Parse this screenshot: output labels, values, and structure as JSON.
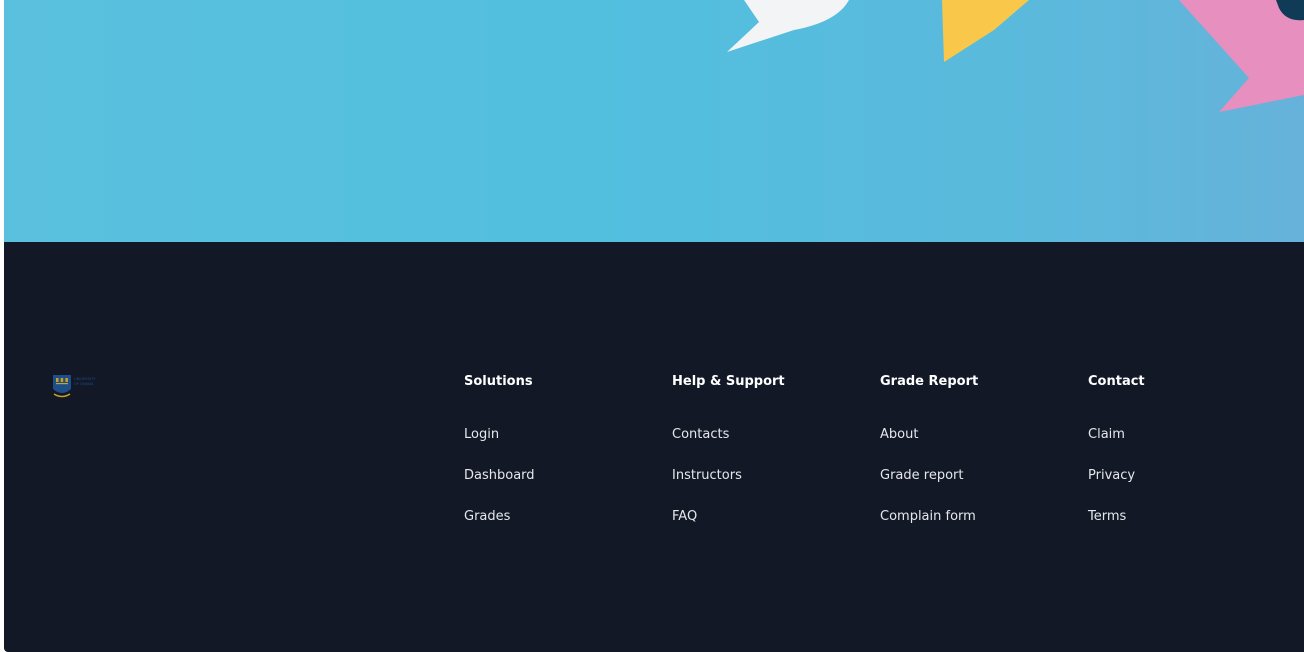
{
  "hero": {
    "background_color": "#55bedf",
    "shape_colors": {
      "white": "#f3f4f5",
      "yellow": "#f9c84a",
      "pink": "#e78fbf",
      "navy": "#0f3b57"
    }
  },
  "footer": {
    "background_color": "#121826",
    "logo": {
      "text_line1": "UNIVERSITY",
      "text_line2": "OF GHANA",
      "crest_color": "#1d4e89",
      "accent_color": "#c9a227"
    },
    "columns": [
      {
        "title": "Solutions",
        "links": [
          "Login",
          "Dashboard",
          "Grades"
        ]
      },
      {
        "title": "Help & Support",
        "links": [
          "Contacts",
          "Instructors",
          "FAQ"
        ]
      },
      {
        "title": "Grade Report",
        "links": [
          "About",
          "Grade report",
          "Complain form"
        ]
      },
      {
        "title": "Contact",
        "links": [
          "Claim",
          "Privacy",
          "Terms"
        ]
      }
    ]
  }
}
